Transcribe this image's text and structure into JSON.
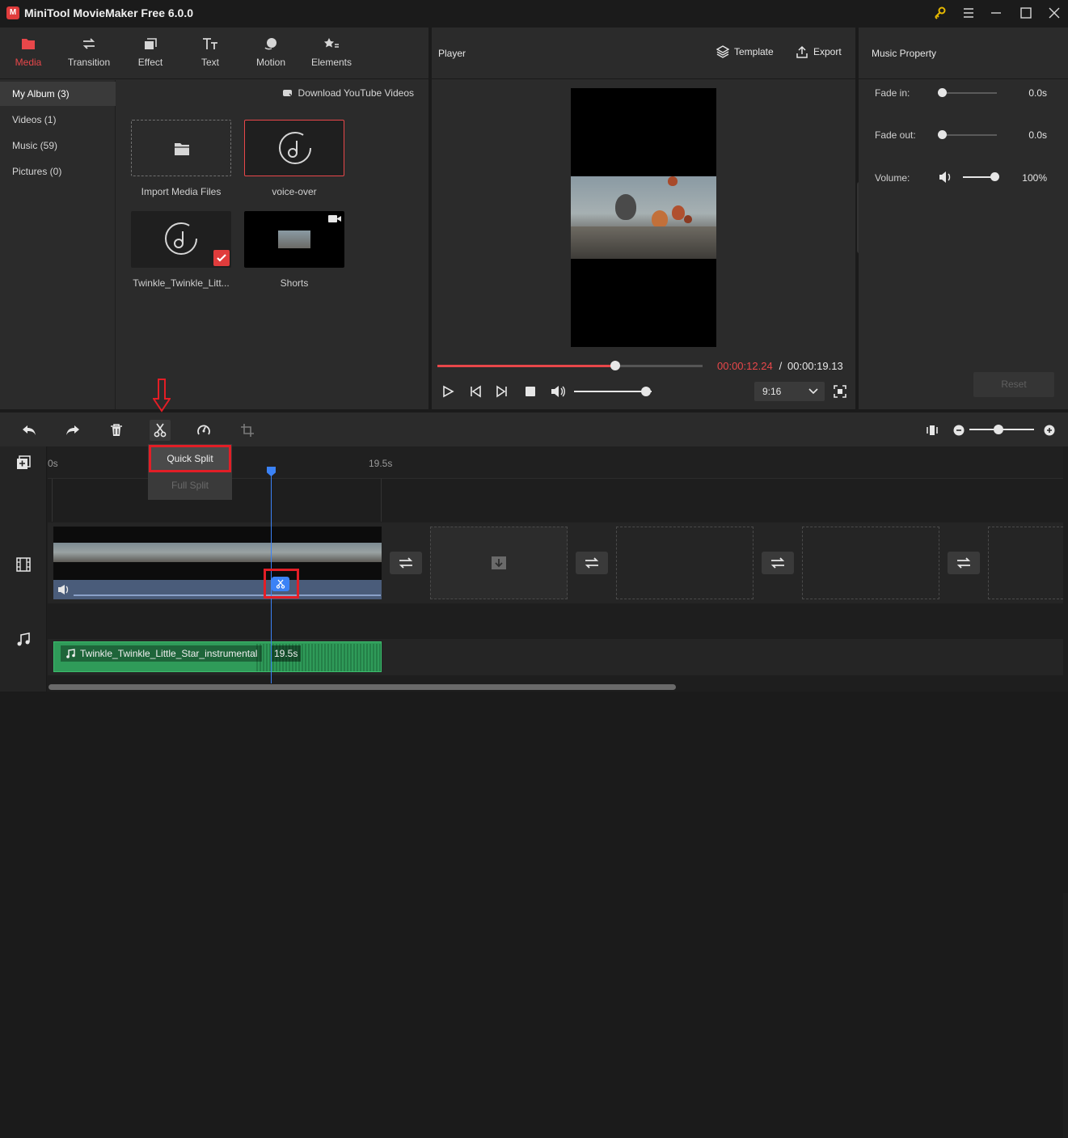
{
  "app": {
    "title": "MiniTool MovieMaker Free 6.0.0",
    "logo_letter": "M"
  },
  "tabs": [
    {
      "label": "Media"
    },
    {
      "label": "Transition"
    },
    {
      "label": "Effect"
    },
    {
      "label": "Text"
    },
    {
      "label": "Motion"
    },
    {
      "label": "Elements"
    }
  ],
  "album_nav": [
    {
      "label": "My Album (3)"
    },
    {
      "label": "Videos (1)"
    },
    {
      "label": "Music (59)"
    },
    {
      "label": "Pictures (0)"
    }
  ],
  "media": {
    "download_label": "Download YouTube Videos",
    "items": [
      {
        "label": "Import Media Files"
      },
      {
        "label": "voice-over"
      },
      {
        "label": "Twinkle_Twinkle_Litt..."
      },
      {
        "label": "Shorts"
      }
    ]
  },
  "player": {
    "title": "Player",
    "template_label": "Template",
    "export_label": "Export",
    "time_current": "00:00:12.24",
    "time_separator": " / ",
    "time_total": "00:00:19.13",
    "progress": 0.67,
    "volume": 0.93,
    "aspect_ratio": "9:16"
  },
  "music_property": {
    "title": "Music Property",
    "fade_in_label": "Fade in:",
    "fade_in_value": "0.0s",
    "fade_out_label": "Fade out:",
    "fade_out_value": "0.0s",
    "volume_label": "Volume:",
    "volume_value": "100%",
    "reset_label": "Reset"
  },
  "split_menu": {
    "quick": "Quick Split",
    "full": "Full Split"
  },
  "timeline": {
    "ruler_start": "0s",
    "ruler_end": "19.5s",
    "music_clip_name": "Twinkle_Twinkle_Little_Star_instrumental",
    "music_clip_duration": "19.5s"
  },
  "colors": {
    "accent": "#e8474a",
    "playhead": "#3b82f6",
    "highlight": "#e21e26",
    "music_clip": "#2f9b59"
  }
}
